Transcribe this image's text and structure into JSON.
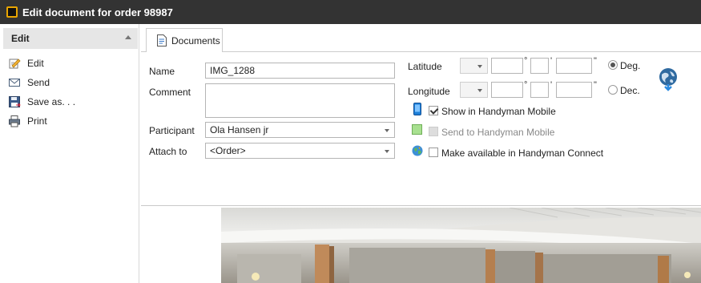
{
  "window": {
    "title": "Edit document for order 98987"
  },
  "sidebar": {
    "header": "Edit",
    "items": [
      {
        "label": "Edit",
        "icon": "edit-icon"
      },
      {
        "label": "Send",
        "icon": "envelope-icon"
      },
      {
        "label": "Save as. . .",
        "icon": "save-icon"
      },
      {
        "label": "Print",
        "icon": "printer-icon"
      }
    ]
  },
  "tabs": [
    {
      "label": "Documents",
      "icon": "document-icon",
      "active": true
    }
  ],
  "form": {
    "name_label": "Name",
    "name_value": "IMG_1288",
    "comment_label": "Comment",
    "comment_value": "",
    "participant_label": "Participant",
    "participant_value": "Ola Hansen jr",
    "attach_label": "Attach to",
    "attach_value": "<Order>",
    "latitude_label": "Latitude",
    "longitude_label": "Longitude",
    "degree_symbol": "°",
    "minute_symbol": "'",
    "second_symbol": "\"",
    "deg_label": "Deg.",
    "dec_label": "Dec.",
    "coord_format_selected": "Deg.",
    "show_mobile_label": "Show in Handyman Mobile",
    "show_mobile_checked": true,
    "send_mobile_label": "Send to Handyman Mobile",
    "send_mobile_checked": false,
    "connect_label": "Make available in Handyman Connect",
    "connect_checked": false
  },
  "colors": {
    "titlebar": "#333333",
    "accent_orange": "#e9a500",
    "mobile_blue": "#1e7fd8",
    "send_green": "#a8e090"
  }
}
